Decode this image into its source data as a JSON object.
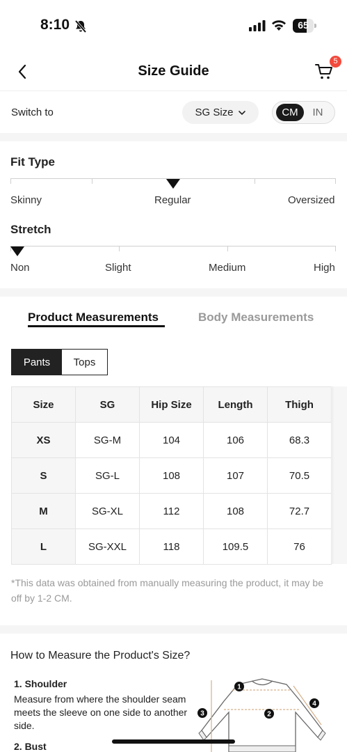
{
  "status": {
    "time": "8:10",
    "battery": "65",
    "battery_level": 0.65
  },
  "header": {
    "title": "Size Guide",
    "cart_count": "5"
  },
  "switch": {
    "label": "Switch to",
    "size_system": "SG Size",
    "unit_cm": "CM",
    "unit_in": "IN",
    "selected_unit": "CM"
  },
  "fit_type": {
    "title": "Fit Type",
    "options": [
      "Skinny",
      "Regular",
      "Oversized"
    ],
    "selected": "Regular"
  },
  "stretch": {
    "title": "Stretch",
    "options": [
      "Non",
      "Slight",
      "Medium",
      "High"
    ],
    "selected": "Non"
  },
  "tabs": {
    "product": "Product Measurements",
    "body": "Body Measurements",
    "active": "product"
  },
  "category": {
    "pants": "Pants",
    "tops": "Tops",
    "active": "pants"
  },
  "table": {
    "headers": [
      "Size",
      "SG",
      "Hip Size",
      "Length",
      "Thigh"
    ],
    "rows": [
      [
        "XS",
        "SG-M",
        "104",
        "106",
        "68.3"
      ],
      [
        "S",
        "SG-L",
        "108",
        "107",
        "70.5"
      ],
      [
        "M",
        "SG-XL",
        "112",
        "108",
        "72.7"
      ],
      [
        "L",
        "SG-XXL",
        "118",
        "109.5",
        "76"
      ]
    ]
  },
  "note": "*This data was obtained from manually measuring the product, it may be off by 1-2 CM.",
  "how_to": {
    "title": "How to Measure the Product's Size?",
    "items": [
      {
        "heading": "1. Shoulder",
        "text": "Measure from where the shoulder seam meets the sleeve on one side to another side."
      },
      {
        "heading": "2. Bust"
      }
    ],
    "diagram_markers": [
      "1",
      "2",
      "3",
      "4"
    ]
  },
  "colors": {
    "accent": "#111111",
    "badge": "#f24a3c",
    "muted": "#9a9a9a"
  }
}
